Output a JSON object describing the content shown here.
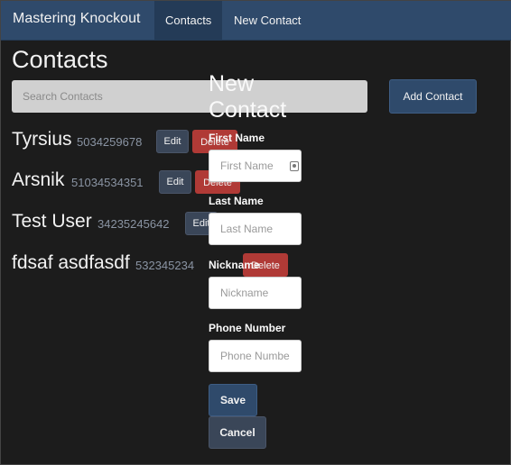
{
  "navbar": {
    "brand": "Mastering Knockout",
    "items": [
      {
        "label": "Contacts"
      },
      {
        "label": "New Contact"
      }
    ]
  },
  "main": {
    "title": "Contacts",
    "search_placeholder": "Search Contacts",
    "add_button": "Add Contact",
    "edit_label": "Edit",
    "delete_label": "Delete",
    "contacts": [
      {
        "name": "Tyrsius",
        "phone": "5034259678"
      },
      {
        "name": "Arsnik",
        "phone": "51034534351"
      },
      {
        "name": "Test User",
        "phone": "34235245642"
      },
      {
        "name": "fdsaf asdfasdf",
        "phone": "532345234"
      }
    ]
  },
  "form": {
    "title": "New Contact",
    "fields": [
      {
        "label": "First Name",
        "placeholder": "First Name"
      },
      {
        "label": "Last Name",
        "placeholder": "Last Name"
      },
      {
        "label": "Nickname",
        "placeholder": "Nickname"
      },
      {
        "label": "Phone Number",
        "placeholder": "Phone Number"
      }
    ],
    "save": "Save",
    "cancel": "Cancel"
  },
  "colors": {
    "navbar": "#2f4a6b",
    "background": "#1c1c1c",
    "danger": "#b03a36",
    "default_button": "#3a4658"
  }
}
